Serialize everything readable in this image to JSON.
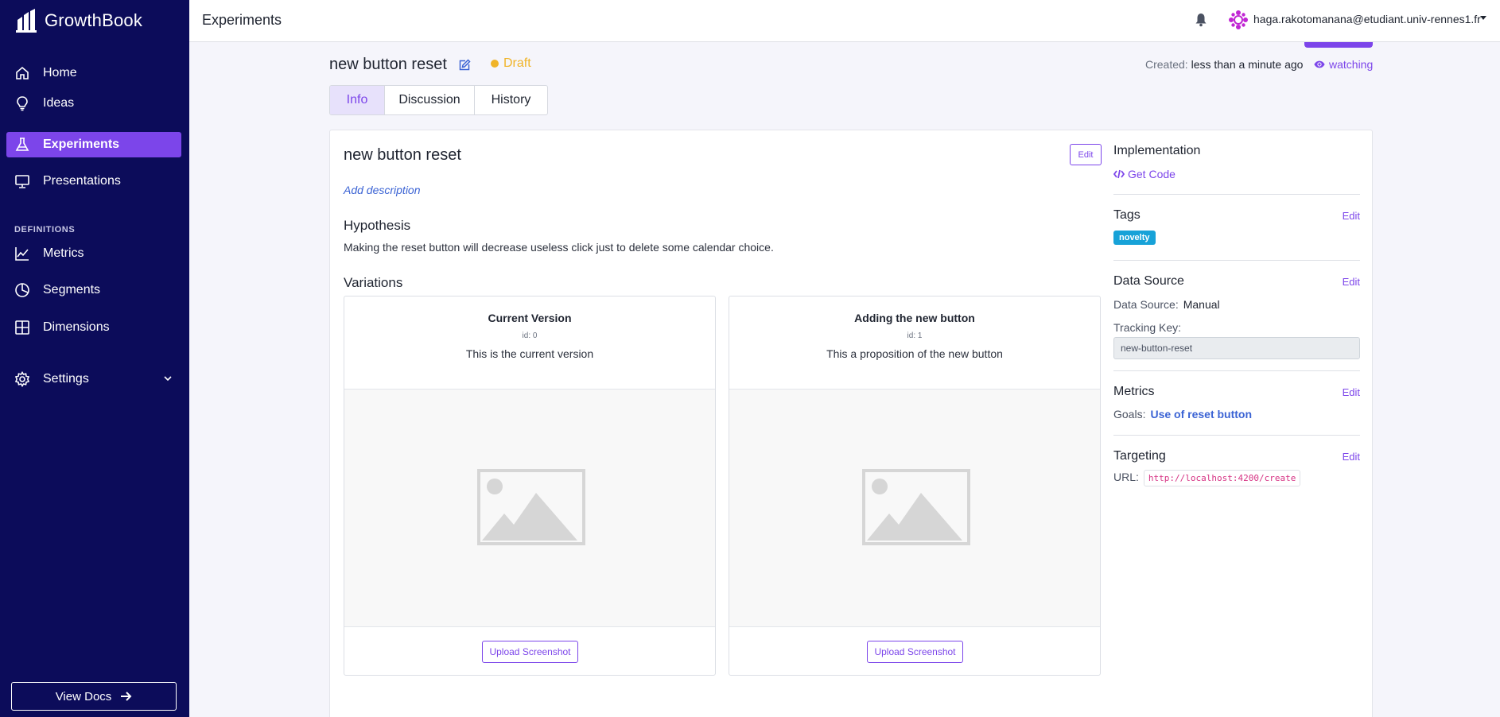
{
  "sidebar": {
    "brand": "GrowthBook",
    "items": [
      {
        "label": "Home",
        "icon": "home-icon"
      },
      {
        "label": "Ideas",
        "icon": "lightbulb-icon"
      },
      {
        "label": "Experiments",
        "icon": "flask-icon",
        "active": true
      },
      {
        "label": "Presentations",
        "icon": "presentation-icon"
      }
    ],
    "definitions_heading": "DEFINITIONS",
    "definitions": [
      {
        "label": "Metrics",
        "icon": "line-chart-icon"
      },
      {
        "label": "Segments",
        "icon": "pie-chart-icon"
      },
      {
        "label": "Dimensions",
        "icon": "grid-icon"
      }
    ],
    "settings_label": "Settings",
    "view_docs_label": "View Docs",
    "bg_color": "#0c0c5a",
    "accent_color": "#7c45ea"
  },
  "topbar": {
    "title": "Experiments",
    "user_email": "haga.rakotomanana@etudiant.univ-rennes1.fr"
  },
  "experiment": {
    "title": "new button reset",
    "status": "Draft",
    "created_label": "Created:",
    "created_value": "less than a minute ago",
    "watching_label": "watching",
    "tabs": [
      "Info",
      "Discussion",
      "History"
    ],
    "active_tab": "Info"
  },
  "info": {
    "card_title": "new button reset",
    "edit_label": "Edit",
    "add_description": "Add description",
    "hypothesis_heading": "Hypothesis",
    "hypothesis_text": "Making the reset button will decrease useless click just to delete some calendar choice.",
    "variations_heading": "Variations",
    "variations": [
      {
        "name": "Current Version",
        "id": "id: 0",
        "description": "This is the current version",
        "upload_label": "Upload Screenshot"
      },
      {
        "name": "Adding the new button",
        "id": "id: 1",
        "description": "This a proposition of the new button",
        "upload_label": "Upload Screenshot"
      }
    ]
  },
  "side": {
    "implementation_heading": "Implementation",
    "get_code_label": "Get Code",
    "tags_heading": "Tags",
    "tags": [
      "novelty"
    ],
    "data_source_heading": "Data Source",
    "data_source_label": "Data Source:",
    "data_source_value": "Manual",
    "tracking_key_label": "Tracking Key:",
    "tracking_key_value": "new-button-reset",
    "metrics_heading": "Metrics",
    "goals_label": "Goals:",
    "goals_value": "Use of reset button",
    "targeting_heading": "Targeting",
    "url_label": "URL:",
    "url_value": "http://localhost:4200/create",
    "edit_label": "Edit"
  }
}
